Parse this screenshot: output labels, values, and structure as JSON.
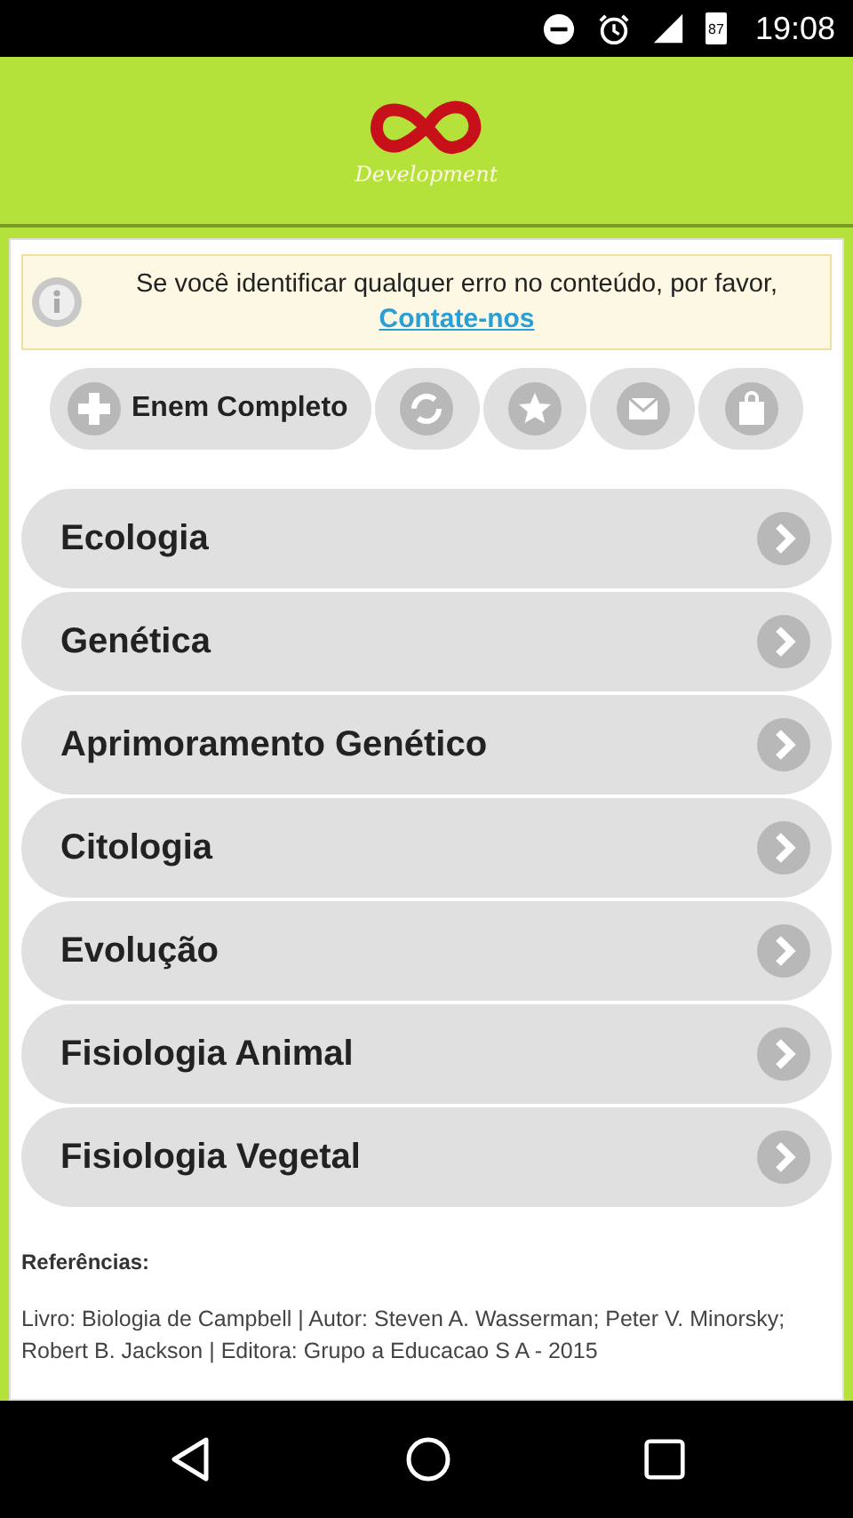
{
  "status_bar": {
    "battery": "87",
    "time": "19:08"
  },
  "header": {
    "logo_text": "Development"
  },
  "notice": {
    "text": "Se você identificar qualquer erro no conteúdo, por favor,",
    "link": "Contate-nos"
  },
  "toolbar": [
    {
      "kind": "plus",
      "label": "Enem Completo"
    },
    {
      "kind": "refresh"
    },
    {
      "kind": "star"
    },
    {
      "kind": "mail"
    },
    {
      "kind": "bag"
    }
  ],
  "topics": [
    {
      "label": "Ecologia"
    },
    {
      "label": "Genética"
    },
    {
      "label": "Aprimoramento Genético"
    },
    {
      "label": "Citologia"
    },
    {
      "label": "Evolução"
    },
    {
      "label": "Fisiologia Animal"
    },
    {
      "label": "Fisiologia Vegetal"
    }
  ],
  "references": {
    "title": "Referências:",
    "items": [
      "Livro: Biologia de Campbell | Autor: Steven A. Wasserman; Peter V. Minorsky; Robert B. Jackson | Editora: Grupo a Educacao S A - 2015"
    ]
  }
}
